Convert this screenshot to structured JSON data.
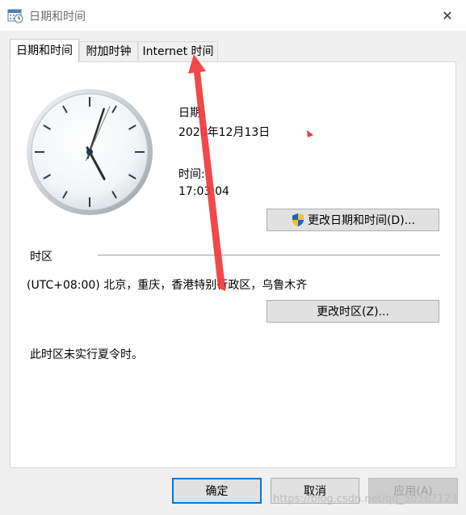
{
  "window": {
    "title": "日期和时间",
    "close_glyph": "✕"
  },
  "tabs": [
    {
      "label": "日期和时间",
      "active": true
    },
    {
      "label": "附加时钟",
      "active": false
    },
    {
      "label": "Internet 时间",
      "active": false
    }
  ],
  "clock": {
    "hour": 17,
    "minute": 3,
    "second": 4
  },
  "date_section": {
    "label": "日期:",
    "value": "2020年12月13日"
  },
  "time_section": {
    "label": "时间:",
    "value": "17:03:04"
  },
  "change_datetime_button": {
    "label": "更改日期和时间(D)...",
    "icon": "uac-shield-icon"
  },
  "timezone": {
    "heading": "时区",
    "value": "(UTC+08:00) 北京，重庆，香港特别行政区，乌鲁木齐",
    "change_button": "更改时区(Z)...",
    "dst_note": "此时区未实行夏令时。"
  },
  "footer": {
    "ok": "确定",
    "cancel": "取消",
    "apply": "应用(A)"
  },
  "watermark": "https://blog.csdn.net/qq_50367123",
  "colors": {
    "annotation_arrow": "#f03a3a",
    "shield_blue": "#1f5fbf",
    "shield_yellow": "#f2c12e"
  }
}
